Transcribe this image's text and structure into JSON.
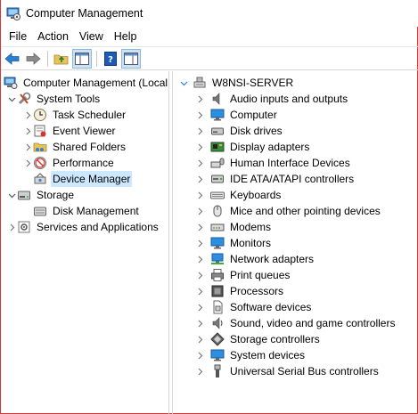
{
  "window": {
    "title": "Computer Management"
  },
  "menu": [
    "File",
    "Action",
    "View",
    "Help"
  ],
  "left_tree": {
    "root": "Computer Management (Local",
    "system_tools": "System Tools",
    "task_scheduler": "Task Scheduler",
    "event_viewer": "Event Viewer",
    "shared_folders": "Shared Folders",
    "performance": "Performance",
    "device_manager": "Device Manager",
    "storage": "Storage",
    "disk_management": "Disk Management",
    "services_and_applications": "Services and Applications"
  },
  "device_tree": {
    "root": "W8NSI-SERVER",
    "categories": [
      "Audio inputs and outputs",
      "Computer",
      "Disk drives",
      "Display adapters",
      "Human Interface Devices",
      "IDE ATA/ATAPI controllers",
      "Keyboards",
      "Mice and other pointing devices",
      "Modems",
      "Monitors",
      "Network adapters",
      "Print queues",
      "Processors",
      "Software devices",
      "Sound, video and game controllers",
      "Storage controllers",
      "System devices",
      "Universal Serial Bus controllers"
    ]
  },
  "colors": {
    "selection": "#cce8ff",
    "border_accent": "#d23a3a",
    "nav_arrow": "#2a7fd4"
  }
}
